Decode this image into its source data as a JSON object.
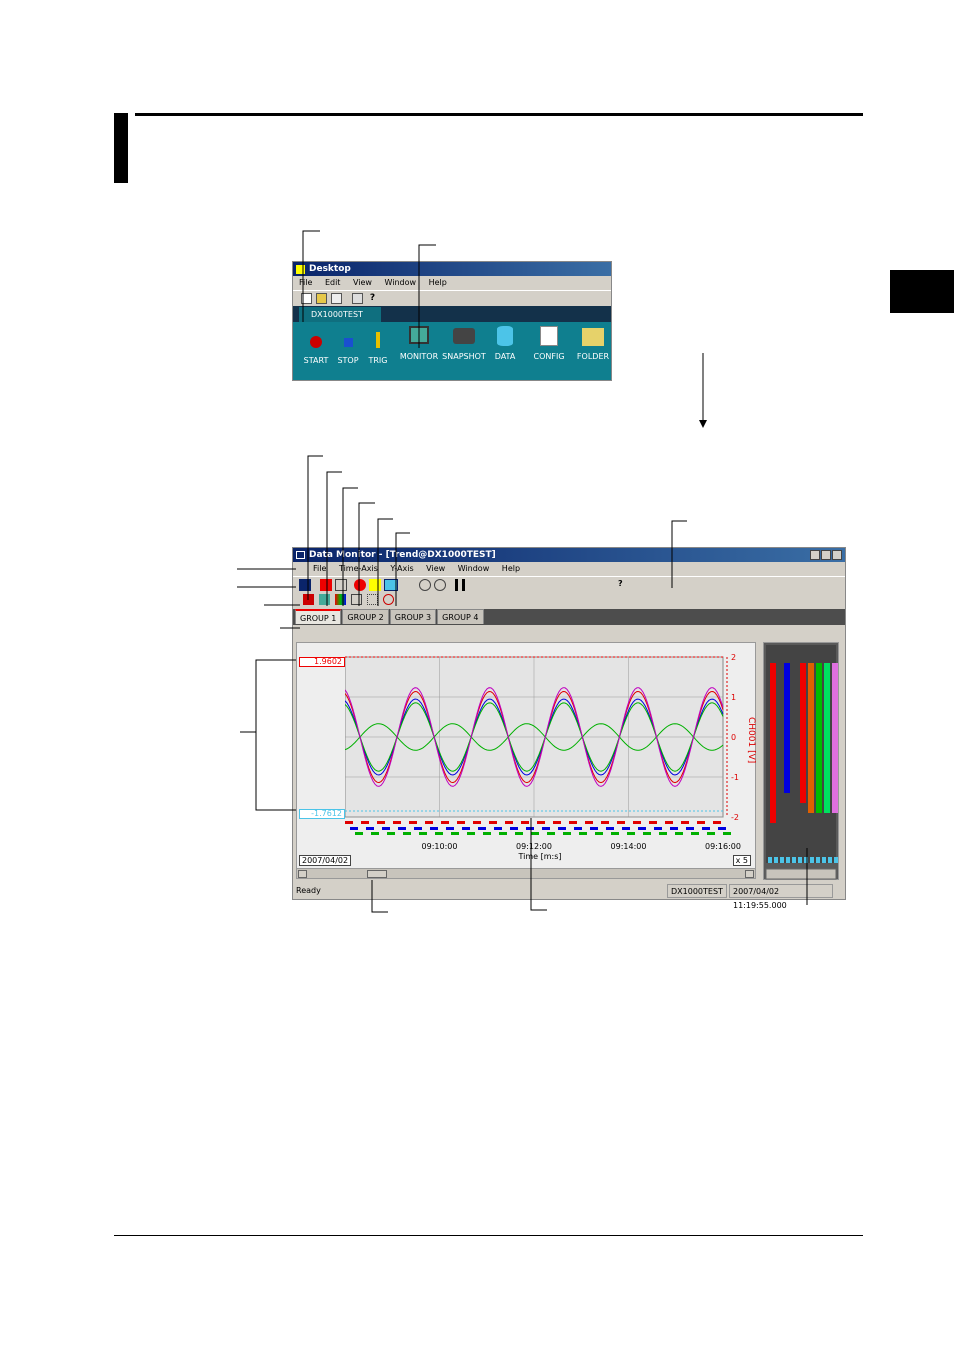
{
  "desktop_window": {
    "title": "Desktop",
    "menu": [
      "File",
      "Edit",
      "View",
      "Window",
      "Help"
    ],
    "tab": "DX1000TEST",
    "launch_items": [
      "START",
      "STOP",
      "TRIG",
      "MONITOR",
      "SNAPSHOT",
      "DATA",
      "CONFIG",
      "FOLDER"
    ]
  },
  "monitor_window": {
    "title": "Data Monitor - [Trend@DX1000TEST]",
    "menu": [
      "File",
      "Time-Axis",
      "Y-Axis",
      "View",
      "Window",
      "Help"
    ],
    "group_tabs": [
      "GROUP 1",
      "GROUP 2",
      "GROUP 3",
      "GROUP 4"
    ],
    "cursor_top_value": "1.9602",
    "cursor_bottom_value": "-1.7612",
    "date_label": "2007/04/02",
    "time_ticks": [
      "09:10:00",
      "09:12:00",
      "09:14:00",
      "09:16:00"
    ],
    "x_axis_label": "Time [m:s]",
    "scale_label": "x 5",
    "y_ticks": [
      "2",
      "1",
      "0",
      "-1",
      "-2"
    ],
    "y_axis_label": "CH001 [V]",
    "status_ready": "Ready",
    "status_device": "DX1000TEST",
    "status_time": "2007/04/02 11:19:55.000"
  },
  "colors": {
    "series": [
      "#e00000",
      "#0000e0",
      "#00b000",
      "#c000c0"
    ],
    "title_bar": "#0a246a",
    "chapter_bar": "#000000"
  }
}
